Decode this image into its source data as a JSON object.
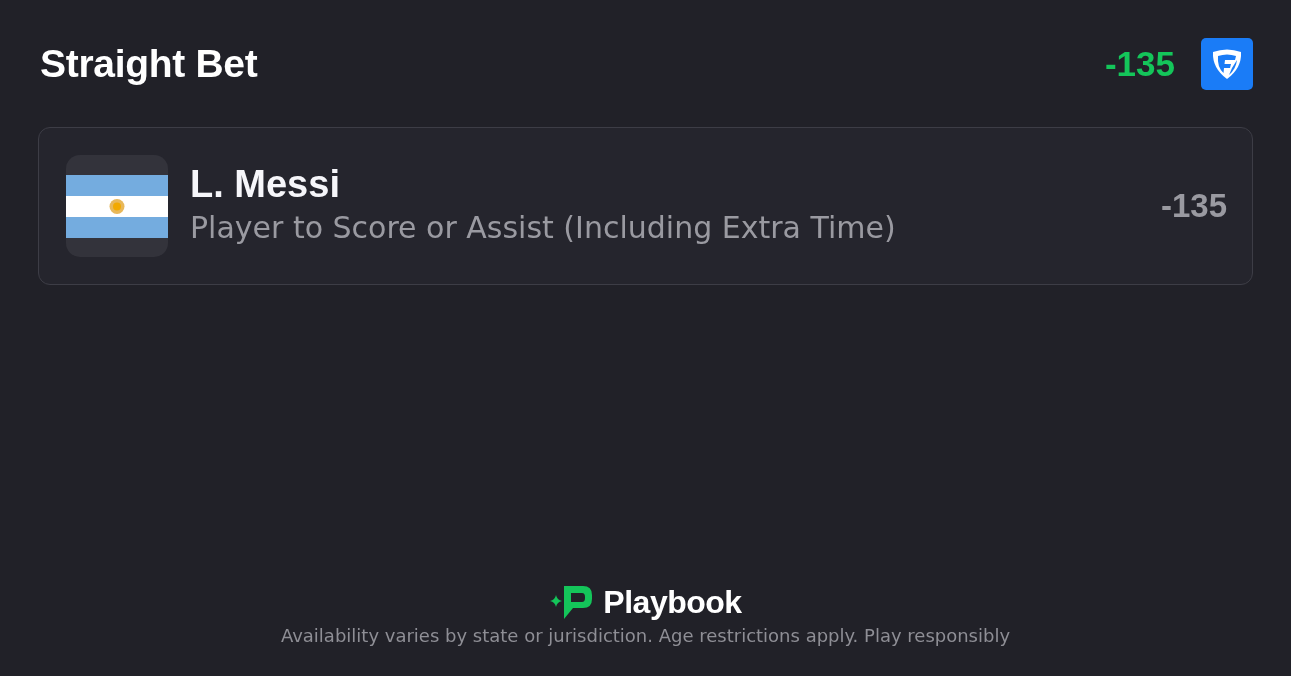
{
  "header": {
    "title": "Straight Bet",
    "odds": "-135"
  },
  "selection": {
    "player": "L. Messi",
    "market": "Player to Score or Assist (Including Extra Time)",
    "odds": "-135"
  },
  "footer": {
    "brand": "Playbook",
    "disclaimer": "Availability varies by state or jurisdiction. Age restrictions apply. Play responsibly"
  }
}
